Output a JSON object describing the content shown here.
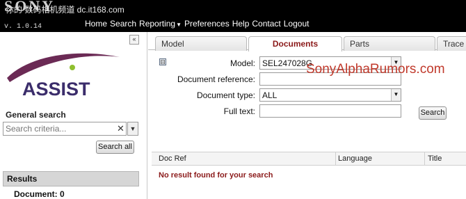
{
  "brand": "SONY",
  "watermark_cn": "你的 数码相机频道 dc.it168.com",
  "watermark_site": "SonyAlphaRumors.com",
  "version": "v. 1.0.14",
  "nav": [
    "Home",
    "Search",
    "Reporting",
    "Preferences",
    "Help",
    "Contact",
    "Logout"
  ],
  "sidebar": {
    "collapse_icon": "«",
    "logo_text": "ASSIST",
    "general_search_title": "General search",
    "search_placeholder": "Search criteria...",
    "search_all_label": "Search all",
    "results_title": "Results",
    "results_document": "Document: 0"
  },
  "tabs": [
    "Model",
    "Documents",
    "Parts",
    "Trace"
  ],
  "active_tab": "Documents",
  "form": {
    "expand_icon": "⊟",
    "model_label": "Model:",
    "model_value": "SEL247028G",
    "docref_label": "Document reference:",
    "docref_value": "",
    "doctype_label": "Document type:",
    "doctype_value": "ALL",
    "fulltext_label": "Full text:",
    "fulltext_value": "",
    "search_label": "Search"
  },
  "grid": {
    "columns": [
      "Doc Ref",
      "Language",
      "Title"
    ],
    "empty_message": "No result found for your search"
  },
  "colors": {
    "topbar": "#000000",
    "accent_text": "#8b1a1a",
    "logo_swoosh": "#6b2a55",
    "logo_dot": "#8fbf2f",
    "logo_text": "#3b2d6b"
  }
}
